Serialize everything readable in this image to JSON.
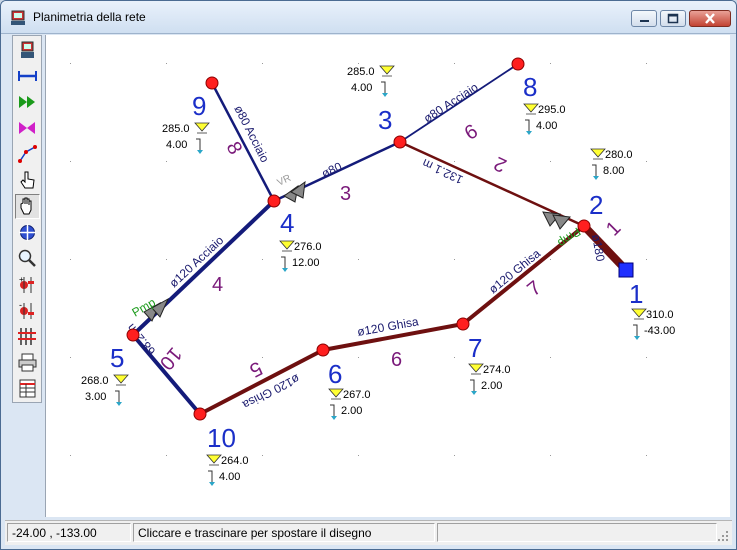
{
  "window": {
    "title": "Planimetria della rete"
  },
  "toolbar": {
    "tools": [
      {
        "id": "node",
        "icon": "node-tool-icon"
      },
      {
        "id": "pipe",
        "icon": "pipe-tool-icon"
      },
      {
        "id": "pump",
        "icon": "pump-tool-icon"
      },
      {
        "id": "valve",
        "icon": "valve-tool-icon"
      },
      {
        "id": "polyline",
        "icon": "polyline-tool-icon"
      },
      {
        "id": "select",
        "icon": "select-hand-icon"
      },
      {
        "id": "pan",
        "icon": "pan-hand-icon"
      },
      {
        "id": "center",
        "icon": "center-target-icon"
      },
      {
        "id": "zoom",
        "icon": "magnifier-icon"
      },
      {
        "id": "zoom-in",
        "icon": "zoom-in-icon"
      },
      {
        "id": "zoom-out",
        "icon": "zoom-out-icon"
      },
      {
        "id": "grid",
        "icon": "grid-bars-icon"
      },
      {
        "id": "print",
        "icon": "printer-icon"
      },
      {
        "id": "table",
        "icon": "table-icon"
      }
    ],
    "active": "pan"
  },
  "colors": {
    "blue_pipe": "#141b7a",
    "red_pipe": "#6e1010",
    "node_fill": "#ff1f1f",
    "reservoir": "#1f2fff",
    "number_blue": "#1b2fc8",
    "pipe_purple": "#7a1a7a",
    "label_blue": "#1b1b6e",
    "pump_green": "#1e9c1e",
    "head_yellow": "#ffff33"
  },
  "nodes": [
    {
      "id": "1",
      "head": "310.0",
      "demand": "-43.00"
    },
    {
      "id": "2",
      "head": "280.0",
      "demand": "8.00"
    },
    {
      "id": "3",
      "head": "285.0",
      "demand": "4.00"
    },
    {
      "id": "4",
      "head": "276.0",
      "demand": "12.00"
    },
    {
      "id": "5",
      "head": "268.0",
      "demand": "3.00"
    },
    {
      "id": "6",
      "head": "267.0",
      "demand": "2.00"
    },
    {
      "id": "7",
      "head": "274.0",
      "demand": "2.00"
    },
    {
      "id": "8",
      "head": "295.0",
      "demand": "4.00"
    },
    {
      "id": "9",
      "head": "285.0",
      "demand": "4.00"
    },
    {
      "id": "10",
      "head": "264.0",
      "demand": "4.00"
    }
  ],
  "pipes": [
    {
      "id": "1",
      "label": "ø180"
    },
    {
      "id": "2",
      "label": "132.1 m"
    },
    {
      "id": "3",
      "label": "ø80"
    },
    {
      "id": "4",
      "label": "ø120 Acciaio"
    },
    {
      "id": "5",
      "label": "ø120 Ghisa"
    },
    {
      "id": "6",
      "label": "ø120 Ghisa"
    },
    {
      "id": "7",
      "label": "ø120 Ghisa"
    },
    {
      "id": "8",
      "label": "ø80 Acciaio"
    },
    {
      "id": "9",
      "label": "ø80 Acciaio"
    },
    {
      "id": "10",
      "label": "68.2 m"
    }
  ],
  "devices": {
    "pump_a": "Pmp",
    "pump_b": "Pmp",
    "valve": "VR"
  },
  "status": {
    "coords": "-24.00 , -133.00",
    "message": "Cliccare e trascinare per spostare il disegno",
    "extra": ""
  }
}
